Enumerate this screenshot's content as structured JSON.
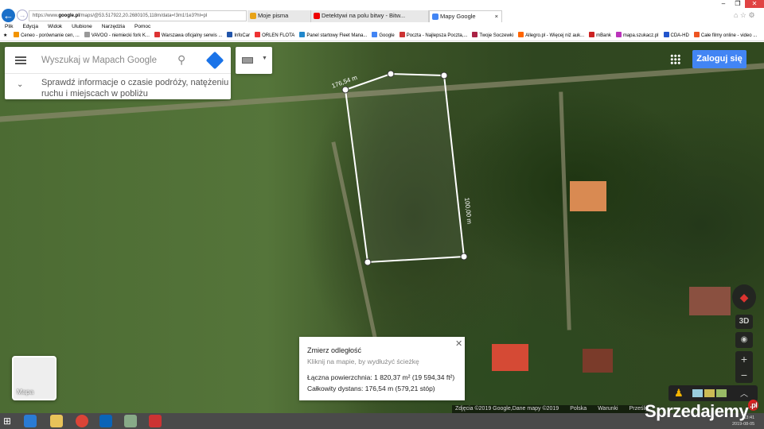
{
  "browser": {
    "url_prefix": "https://www.",
    "url_domain": "google.pl",
    "url_rest": "/maps/@53.517922,20.2680105,118m/data=!3m1!1e3?hl=pl",
    "tabs": [
      {
        "label": "Moje pisma",
        "color": "#e8a317"
      },
      {
        "label": "Detektywi na polu bitwy - Bitw...",
        "color": "#e00"
      },
      {
        "label": "Mapy Google",
        "color": "#4285f4",
        "active": true
      }
    ],
    "menu": [
      "Plik",
      "Edycja",
      "Widok",
      "Ulubione",
      "Narzędzia",
      "Pomoc"
    ],
    "favorites": [
      {
        "label": "Ceneo - porównanie cen, ...",
        "color": "#f29400"
      },
      {
        "label": "VAVOO - niemiecki fork K...",
        "color": "#999"
      },
      {
        "label": "Warszawa oficjalny serwis ...",
        "color": "#d33"
      },
      {
        "label": "InfoCar",
        "color": "#25a"
      },
      {
        "label": "ORLEN FLOTA",
        "color": "#e33"
      },
      {
        "label": "Panel startowy Fleet Mana...",
        "color": "#28c"
      },
      {
        "label": "Google",
        "color": "#4285f4"
      },
      {
        "label": "Poczta - Najlepsza Poczta,...",
        "color": "#c33"
      },
      {
        "label": "Twoje Soczewki",
        "color": "#a24"
      },
      {
        "label": "Allegro.pl - Więcej niż auk...",
        "color": "#f60"
      },
      {
        "label": "mBank",
        "color": "#c22"
      },
      {
        "label": "mapa.szukacz.pl",
        "color": "#b3b"
      },
      {
        "label": "CDA-HD",
        "color": "#25c"
      },
      {
        "label": "Całe filmy online - video ...",
        "color": "#e52"
      }
    ]
  },
  "maps": {
    "search_placeholder": "Wyszukaj w Mapach Google",
    "hint": "Sprawdź informacje o czasie podróży, natężeniu ruchu i miejscach w pobliżu",
    "login": "Zaloguj się",
    "map_type": "Mapa",
    "btn_3d": "3D",
    "measure": {
      "title": "Zmierz odległość",
      "subtitle": "Kliknij na mapie, by wydłużyć ścieżkę",
      "area": "Łączna powierzchnia: 1 820,37 m² (19 594,34 ft²)",
      "distance": "Całkowity dystans: 176,54 m (579,21 stóp)",
      "label_top": "176,54 m",
      "label_side": "100,00 m"
    },
    "attribution": [
      "Zdjęcia ©2019 Google,Dane mapy ©2019",
      "Polska",
      "Warunki",
      "Prześlij"
    ]
  },
  "watermark": "Sprzedajemy",
  "watermark_tld": ".pl",
  "clock": {
    "time": "13:41",
    "date": "2019-08-05"
  }
}
